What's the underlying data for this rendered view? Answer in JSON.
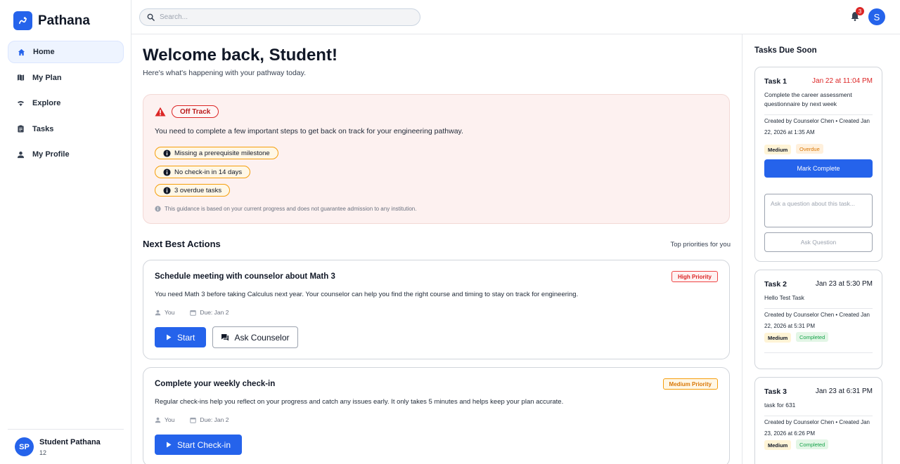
{
  "brand": {
    "name": "Pathana"
  },
  "nav": {
    "items": [
      {
        "label": "Home"
      },
      {
        "label": "My Plan"
      },
      {
        "label": "Explore"
      },
      {
        "label": "Tasks"
      },
      {
        "label": "My Profile"
      }
    ]
  },
  "user": {
    "initials": "SP",
    "name": "Student Pathana",
    "grade": "12"
  },
  "topbar": {
    "search_placeholder": "Search...",
    "notification_count": "3",
    "avatar_initial": "S"
  },
  "welcome": {
    "title": "Welcome back, Student!",
    "subtitle": "Here's what's happening with your pathway today."
  },
  "alert": {
    "status": "Off Track",
    "message": "You need to complete a few important steps to get back on track for your engineering pathway.",
    "reasons": [
      "Missing a prerequisite milestone",
      "No check-in in 14 days",
      "3 overdue tasks"
    ],
    "note": "This guidance is based on your current progress and does not guarantee admission to any institution."
  },
  "next_actions": {
    "title": "Next Best Actions",
    "subtitle": "Top priorities for you",
    "items": [
      {
        "title": "Schedule meeting with counselor about Math 3",
        "priority": "High Priority",
        "description": "You need Math 3 before taking Calculus next year. Your counselor can help you find the right course and timing to stay on track for engineering.",
        "owner": "You",
        "due": "Due: Jan 2",
        "primary_label": "Start",
        "secondary_label": "Ask Counselor"
      },
      {
        "title": "Complete your weekly check-in",
        "priority": "Medium Priority",
        "description": "Regular check-ins help you reflect on your progress and catch any issues early. It only takes 5 minutes and helps keep your plan accurate.",
        "owner": "You",
        "due": "Due: Jan 2",
        "primary_label": "Start Check-in"
      }
    ]
  },
  "tasks_panel": {
    "title": "Tasks Due Soon",
    "tasks": [
      {
        "name": "Task 1",
        "due": "Jan 22 at 11:04 PM",
        "description": "Complete the career assessment questionnaire by next week",
        "created": "Created by Counselor Chen • Created Jan 22, 2026 at 1:35 AM",
        "tags": [
          "Medium",
          "Overdue"
        ],
        "mark_complete_label": "Mark Complete",
        "question_placeholder": "Ask a question about this task...",
        "ask_label": "Ask Question"
      },
      {
        "name": "Task 2",
        "due": "Jan 23 at 5:30 PM",
        "description": "Hello Test Task",
        "created": "Created by Counselor Chen • Created Jan 22, 2026 at 5:31 PM",
        "tags": [
          "Medium",
          "Completed"
        ]
      },
      {
        "name": "Task 3",
        "due": "Jan 23 at 6:31 PM",
        "description": "task for 631",
        "created": "Created by Counselor Chen • Created Jan 23, 2026 at 6:26 PM",
        "tags": [
          "Medium",
          "Completed"
        ]
      }
    ]
  },
  "colors": {
    "accent": "#2563eb",
    "danger": "#dc2626",
    "warning": "#f59e0b",
    "success": "#16a34a"
  }
}
